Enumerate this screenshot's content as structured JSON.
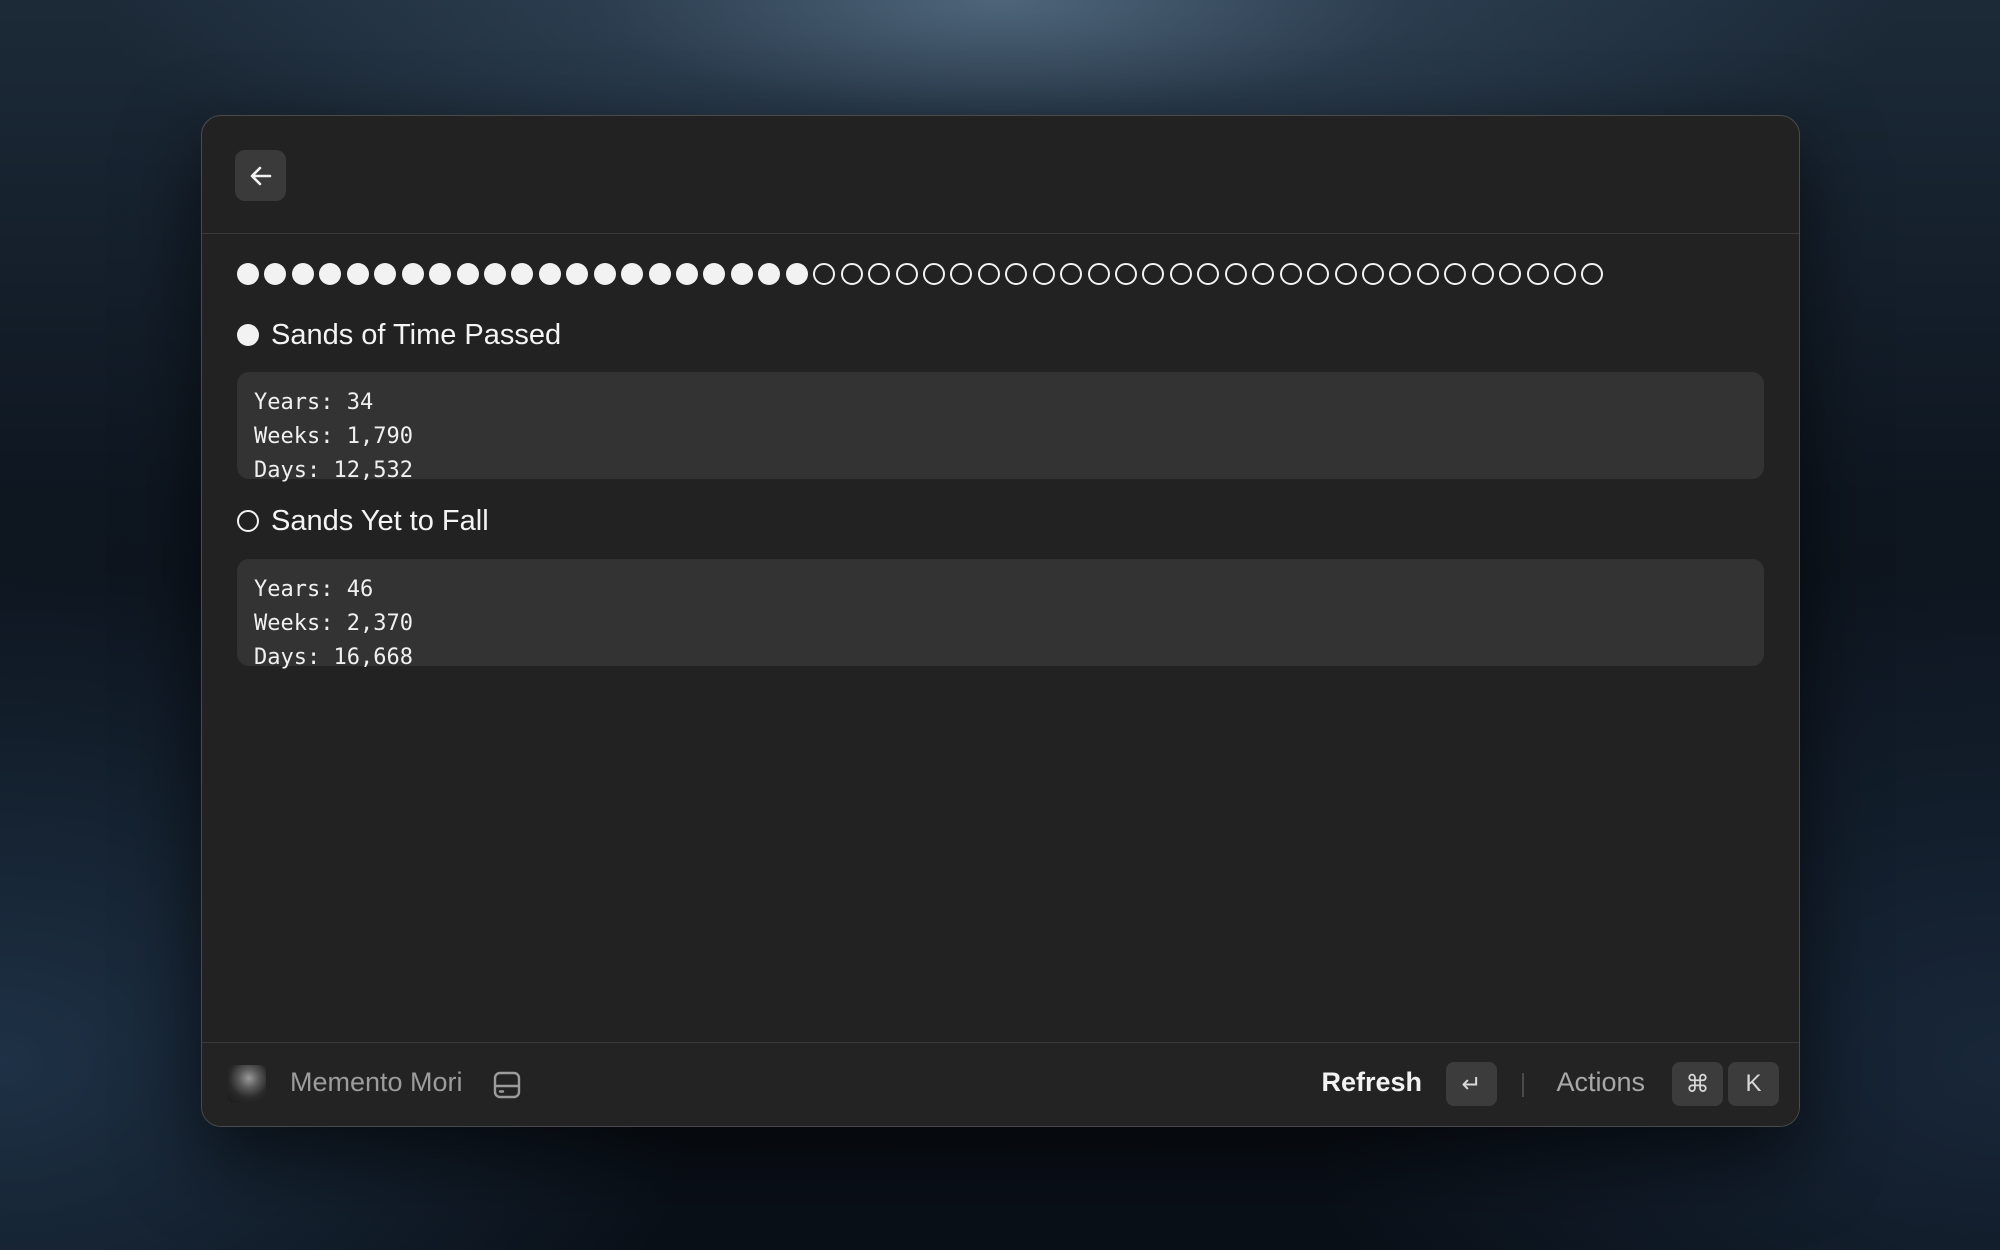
{
  "header": {
    "back_icon": "arrow-left-icon"
  },
  "progress": {
    "filled_count": 21,
    "empty_count": 29,
    "filled_symbol": "●",
    "empty_symbol": "○"
  },
  "sections": {
    "passed": {
      "title": "Sands of Time Passed",
      "marker_icon": "filled-circle-icon",
      "years": "Years: 34",
      "weeks": "Weeks: 1,790",
      "days": "Days: 12,532"
    },
    "remaining": {
      "title": "Sands Yet to Fall",
      "marker_icon": "empty-circle-icon",
      "years": "Years: 46",
      "weeks": "Weeks: 2,370",
      "days": "Days: 16,668"
    }
  },
  "footer": {
    "extension_name": "Memento Mori",
    "extension_icon": "statue-avatar-icon",
    "storage_icon": "hard-drive-icon",
    "primary_action": "Refresh",
    "primary_shortcut": "↵",
    "secondary_action": "Actions",
    "secondary_shortcut_mod": "⌘",
    "secondary_shortcut_key": "K"
  },
  "colors": {
    "window_bg": "#222222",
    "box_bg": "#333333",
    "text": "#f4f4f4",
    "muted_text": "#9c9c9c"
  }
}
